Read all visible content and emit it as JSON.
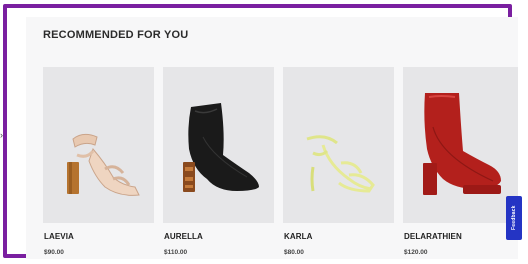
{
  "section": {
    "title": "RECOMMENDED FOR YOU"
  },
  "products": [
    {
      "name": "LAEVIA",
      "price": "$90.00",
      "icon": "nude-block-heel-sandal-icon"
    },
    {
      "name": "AURELLA",
      "price": "$110.00",
      "icon": "black-block-heel-bootie-icon"
    },
    {
      "name": "KARLA",
      "price": "$80.00",
      "icon": "yellow-strappy-heel-sandal-icon"
    },
    {
      "name": "DELARATHIEN",
      "price": "$120.00",
      "icon": "red-platform-boot-icon"
    }
  ],
  "feedback": {
    "label": "Feedback"
  },
  "colors": {
    "frame": "#7a1fa0",
    "feedback_tab": "#2434c4",
    "card_bg": "#e6e6e8"
  }
}
